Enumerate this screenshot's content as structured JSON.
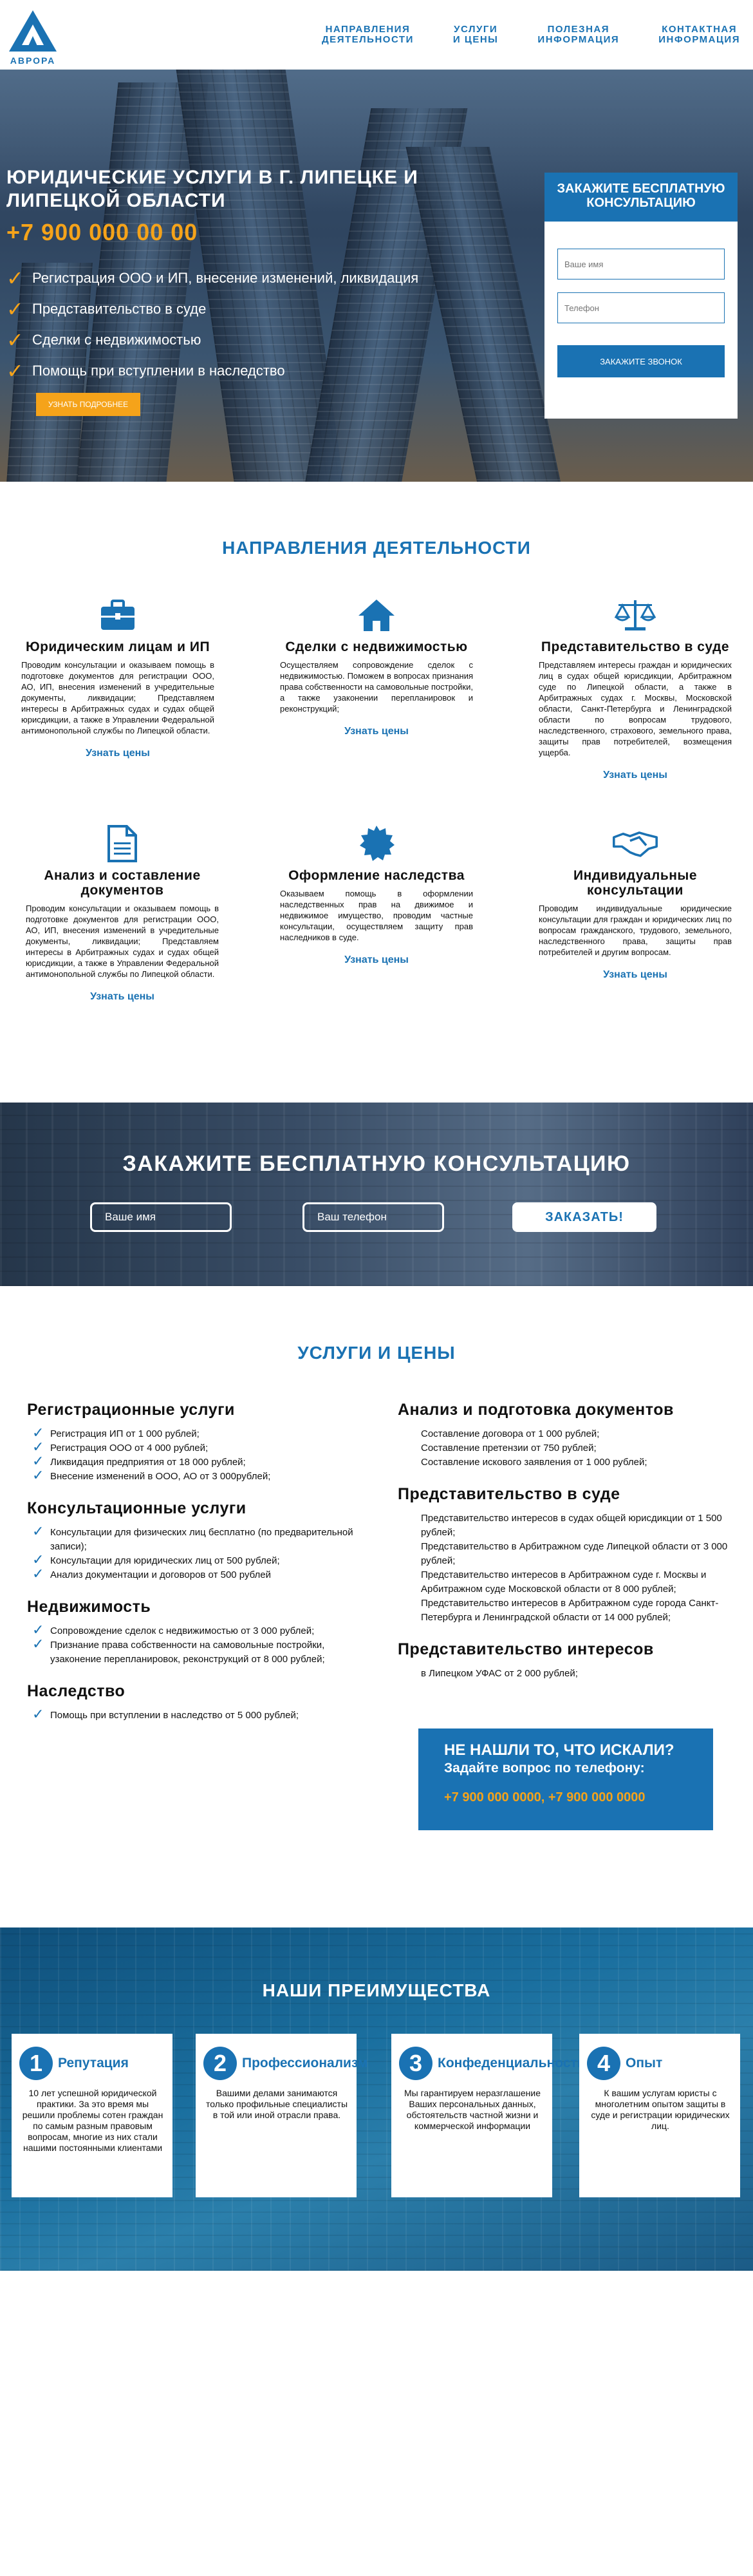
{
  "header": {
    "logo_text": "АВРОРА",
    "nav": [
      {
        "label": "НАПРАВЛЕНИЯ\nДЕЯТЕЛЬНОСТИ"
      },
      {
        "label": "УСЛУГИ\nИ ЦЕНЫ"
      },
      {
        "label": "ПОЛЕЗНАЯ\nИНФОРМАЦИЯ"
      },
      {
        "label": "КОНТАКТНАЯ\nИНФОРМАЦИЯ"
      }
    ]
  },
  "hero": {
    "title": "ЮРИДИЧЕСКИЕ УСЛУГИ В Г. ЛИПЕЦКЕ И ЛИПЕЦКОЙ ОБЛАСТИ",
    "phone": "+7 900 000 00 00",
    "bullets": [
      "Регистрация ООО и ИП, внесение изменений, ликвидация",
      "Представительство в суде",
      "Сделки с недвижимостью",
      "Помощь при вступлении в наследство"
    ],
    "more_button": "УЗНАТЬ ПОДРОБНЕЕ"
  },
  "form": {
    "title": "ЗАКАЖИТЕ БЕСПЛАТНУЮ КОНСУЛЬТАЦИЮ",
    "name_placeholder": "Ваше имя",
    "phone_placeholder": "Телефон",
    "submit": "ЗАКАЖИТЕ ЗВОНОК"
  },
  "directions": {
    "title": "НАПРАВЛЕНИЯ ДЕЯТЕЛЬНОСТИ",
    "link_label": "Узнать цены",
    "items": [
      {
        "icon": "briefcase-icon",
        "title": "Юридическим лицам и ИП",
        "text": "Проводим консультации и оказываем помощь в подготовке документов для регистрации ООО, АО, ИП, внесения изменений в учредительные документы, ликвидации; Представляем интересы в Арбитражных судах и судах общей юрисдикции, а также в Управлении Федеральной антимонопольной службы по Липецкой области."
      },
      {
        "icon": "house-icon",
        "title": "Сделки с недвижимостью",
        "text": "Осуществляем сопровождение сделок с недвижимостью. Поможем в вопросах признания права собственности на самовольные постройки, а также узаконении перепланировок и реконструкций;"
      },
      {
        "icon": "scales-icon",
        "title": "Представительство в суде",
        "text": "Представляем интересы граждан и юридических лиц в судах общей юрисдикции, Арбитражном суде по Липецкой области, а также в Арбитражных судах г. Москвы, Московской области, Санкт-Петербурга и Ленинградской области по вопросам трудового, наследственного, страхового, земельного права, защиты прав потребителей, возмещения ущерба."
      },
      {
        "icon": "document-icon",
        "title": "Анализ и составление документов",
        "text": "Проводим консультации и оказываем помощь в подготовке документов для регистрации ООО, АО, ИП, внесения изменений в учредительные документы, ликвидации; Представляем интересы в Арбитражных судах и судах общей юрисдикции, а также в Управлении Федеральной антимонопольной службы по Липецкой области."
      },
      {
        "icon": "seal-icon",
        "title": "Оформление наследства",
        "text": "Оказываем помощь в оформлении наследственных прав на движимое и недвижимое имущество, проводим частные консультации, осуществляем защиту прав наследников в суде."
      },
      {
        "icon": "handshake-icon",
        "title": "Индивидуальные консультации",
        "text": "Проводим индивидуальные юридические консультации для граждан и юридических лиц по вопросам гражданского, трудового, земельного, наследственного права, защиты прав потребителей и другим вопросам."
      }
    ]
  },
  "cta": {
    "title": "ЗАКАЖИТЕ БЕСПЛАТНУЮ КОНСУЛЬТАЦИЮ",
    "name_placeholder": "Ваше имя",
    "phone_placeholder": "Ваш телефон",
    "submit": "ЗАКАЗАТЬ!"
  },
  "prices": {
    "title": "УСЛУГИ И ЦЕНЫ",
    "left": [
      {
        "heading": "Регистрационные услуги",
        "items": [
          "Регистрация ИП от 1 000 рублей;",
          "Регистрация ООО от 4 000 рублей;",
          "Ликвидация предприятия от 18 000 рублей;",
          "Внесение изменений в ООО, АО от 3 000рублей;"
        ]
      },
      {
        "heading": "Консультационные услуги",
        "items": [
          "Консультации для физических лиц бесплатно (по предварительной записи);",
          "Консультации для юридических лиц от 500 рублей;",
          "Анализ документации и договоров от 500 рублей"
        ]
      },
      {
        "heading": "Недвижимость",
        "items": [
          "Сопровождение сделок с недвижимостью от 3 000 рублей;",
          "Признание права собственности на самовольные постройки, узаконение перепланировок, реконструкций от 8 000 рублей;"
        ]
      },
      {
        "heading": "Наследство",
        "items": [
          "Помощь при вступлении в наследство от 5 000 рублей;"
        ]
      }
    ],
    "right": [
      {
        "heading": "Анализ и подготовка документов",
        "items": [
          "Составление договора от 1 000 рублей;",
          "Составление претензии от 750 рублей;",
          "Составление искового заявления от 1 000 рублей;"
        ]
      },
      {
        "heading": "Представительство в суде",
        "items": [
          "Представительство интересов в судах общей юрисдикции от 1 500 рублей;",
          "Представительство в Арбитражном суде Липецкой области от 3 000 рублей;",
          "Представительство интересов в Арбитражном суде г. Москвы и Арбитражном суде Московской области от 8 000 рублей;",
          "Представительство интересов в Арбитражном суде города Санкт-Петербурга и Ленинградской области от 14 000 рублей;"
        ]
      },
      {
        "heading": "Представительство интересов",
        "items": [
          "в Липецком УФАС от 2 000 рублей;"
        ]
      }
    ],
    "promo": {
      "line1": "НЕ НАШЛИ ТО, ЧТО ИСКАЛИ?",
      "line2": "Задайте вопрос по телефону:",
      "phones": "+7 900 000 0000, +7 900 000 0000"
    }
  },
  "advantages": {
    "title": "НАШИ ПРЕИМУЩЕСТВА",
    "items": [
      {
        "num": "1",
        "title": "Репутация",
        "text": "10 лет успешной юридической практики. За это время мы решили проблемы сотен граждан по самым разным правовым вопросам, многие из них стали нашими постоянными клиентами"
      },
      {
        "num": "2",
        "title": "Профессионализм",
        "text": "Вашими делами занимаются только профильные специалисты в той или иной отрасли права."
      },
      {
        "num": "3",
        "title": "Конфеденциальность",
        "text": "Мы гарантируем неразглашение Ваших персональных данных, обстоятельств частной жизни и коммерческой информации"
      },
      {
        "num": "4",
        "title": "Опыт",
        "text": "К вашим услугам юристы с многолетним опытом защиты в суде и регистрации юридических лиц."
      }
    ]
  },
  "colors": {
    "accent": "#1a72b3",
    "orange": "#f5a31a"
  }
}
